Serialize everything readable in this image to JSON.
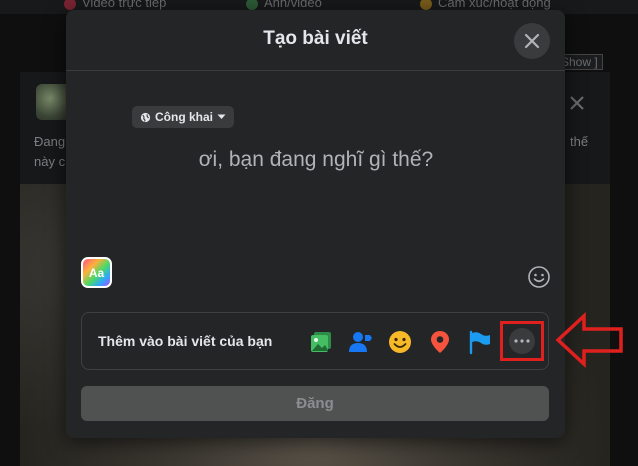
{
  "background": {
    "top_items": [
      {
        "label": "Video trực tiếp",
        "color": "#f3425f"
      },
      {
        "label": "Ảnh/video",
        "color": "#45bd62"
      },
      {
        "label": "Cảm xúc/hoạt động",
        "color": "#f7b928"
      }
    ],
    "show_tag": "Show ]",
    "post_text_left_1": "Đang",
    "post_text_left_2": "này c",
    "post_text_right": "thế"
  },
  "modal": {
    "title": "Tạo bài viết",
    "privacy": {
      "label": "Công khai",
      "icon": "globe-icon"
    },
    "composer_placeholder": "ơi, bạn đang nghĩ gì thế?",
    "text_style_label": "Aa",
    "add_to_post": {
      "label": "Thêm vào bài viết của bạn",
      "items": [
        {
          "name": "photo-video",
          "icon": "photo-icon",
          "color": "#45bd62"
        },
        {
          "name": "tag-people",
          "icon": "tag-people-icon",
          "color": "#1877f2"
        },
        {
          "name": "feeling-activity",
          "icon": "smile-icon",
          "color": "#f7b928"
        },
        {
          "name": "check-in",
          "icon": "location-pin-icon",
          "color": "#f5533d"
        },
        {
          "name": "life-event",
          "icon": "flag-icon",
          "color": "#1b9cf0"
        },
        {
          "name": "more",
          "icon": "more-dots-icon",
          "color": "#b0b3b8"
        }
      ]
    },
    "post_button_label": "Đăng"
  },
  "colors": {
    "highlight": "#e0201f",
    "modal_bg": "#242526",
    "disabled_button": "#505151"
  }
}
